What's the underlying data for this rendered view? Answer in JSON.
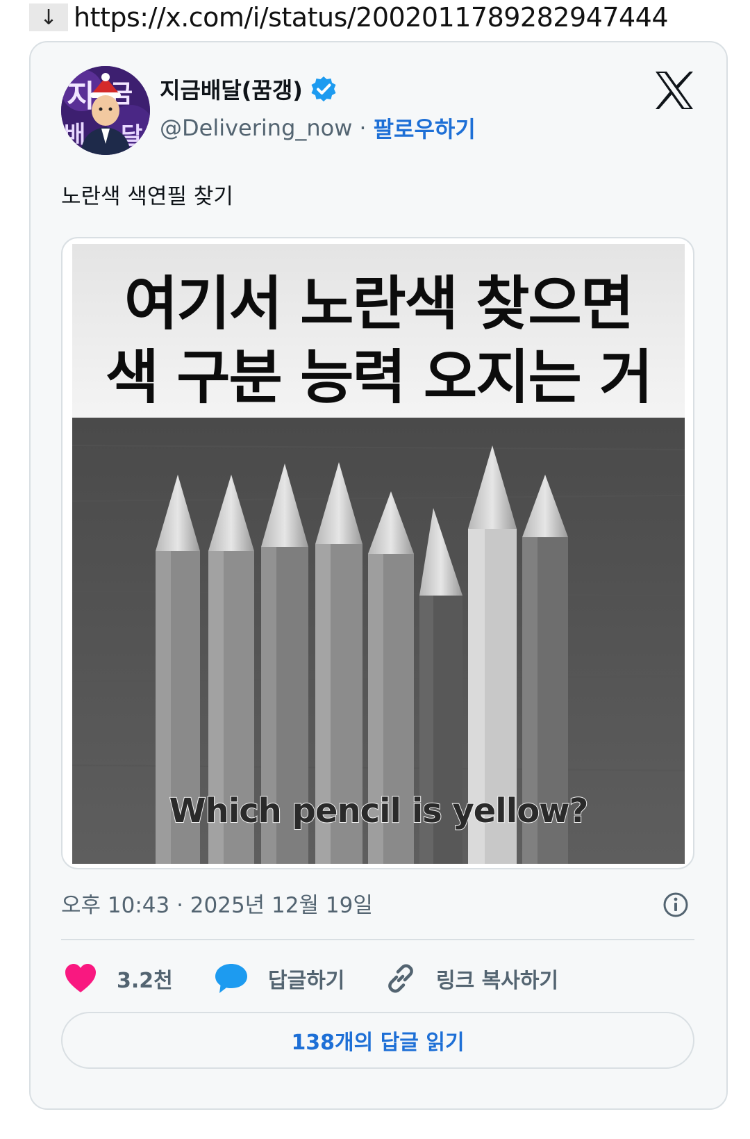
{
  "url_bar": {
    "arrow_icon": "down-arrow-icon",
    "url": "https://x.com/i/status/2002011789282947444"
  },
  "tweet": {
    "display_name": "지금배달(꿈갱)",
    "handle": "@Delivering_now",
    "separator": "·",
    "follow_label": "팔로우하기",
    "text": "노란색 색연필 찾기",
    "media": {
      "headline_line1": "여기서 노란색 찾으면",
      "headline_line2": "색 구분 능력 오지는 거",
      "caption": "Which pencil is yellow?"
    },
    "timestamp": "오후 10:43 · 2025년 12월 19일",
    "actions": {
      "likes": "3.2천",
      "reply_label": "답글하기",
      "copy_link_label": "링크 복사하기"
    },
    "read_replies_label": "138개의 답글 읽기"
  },
  "colors": {
    "accent_blue": "#1d6fd6",
    "like_pink": "#f91880",
    "reply_blue": "#1d9bf0",
    "verified_blue": "#1d9bf0"
  }
}
